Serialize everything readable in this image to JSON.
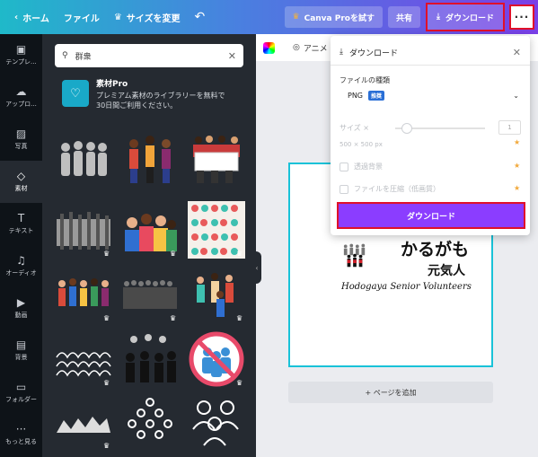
{
  "topbar": {
    "home": "ホーム",
    "file": "ファイル",
    "resize": "サイズを変更",
    "pro_button": "Canva Proを試す",
    "share": "共有",
    "download": "ダウンロード",
    "more": "···"
  },
  "rail": [
    {
      "label": "テンプレ...",
      "icon": "template-icon"
    },
    {
      "label": "アップロ...",
      "icon": "upload-icon"
    },
    {
      "label": "写真",
      "icon": "photo-icon"
    },
    {
      "label": "素材",
      "icon": "elements-icon"
    },
    {
      "label": "テキスト",
      "icon": "text-icon"
    },
    {
      "label": "オーディオ",
      "icon": "audio-icon"
    },
    {
      "label": "動画",
      "icon": "video-icon"
    },
    {
      "label": "背景",
      "icon": "background-icon"
    },
    {
      "label": "フォルダー",
      "icon": "folder-icon"
    },
    {
      "label": "もっと見る",
      "icon": "more-icon"
    }
  ],
  "panel": {
    "search_value": "群衆",
    "promo_title": "素材Pro",
    "promo_line1": "プレミアム素材のライブラリーを無料で",
    "promo_line2": "30日間ご利用ください。"
  },
  "canvas": {
    "animate": "アニメ",
    "add_page": "+ ページを追加",
    "art_title": "かるがも",
    "art_sub": "元気人",
    "art_en": "Hodogaya Senior Volunteers"
  },
  "download_panel": {
    "title": "ダウンロード",
    "file_type_label": "ファイルの種類",
    "file_type_value": "PNG",
    "badge": "推奨",
    "size_label": "サイズ ×",
    "size_value": "1",
    "size_px": "500 × 500 px",
    "transparent_bg": "透過背景",
    "compress": "ファイルを圧縮（低画質）",
    "download_button": "ダウンロード"
  },
  "colors": {
    "accent_purple": "#8b3dff",
    "highlight_red": "#e0102a",
    "panel_dark": "#252a31",
    "selection_cyan": "#19c2d8"
  }
}
